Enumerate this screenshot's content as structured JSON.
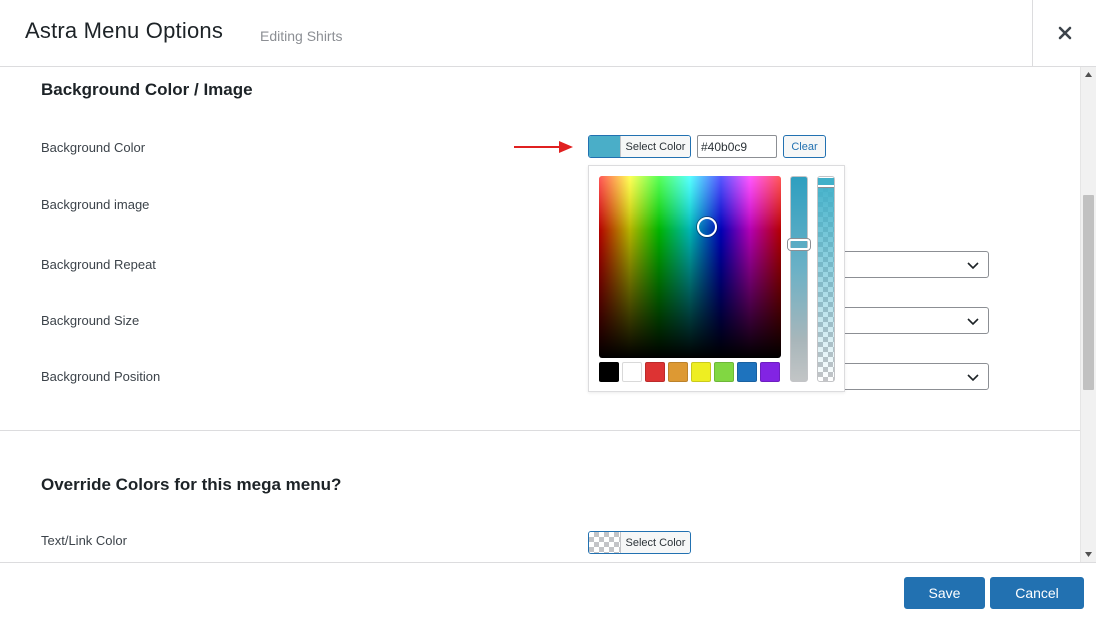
{
  "header": {
    "title": "Astra Menu Options",
    "subtitle": "Editing Shirts",
    "close_icon": "close-icon"
  },
  "sections": {
    "background": {
      "title": "Background Color / Image",
      "rows": {
        "color": "Background Color",
        "image": "Background image",
        "repeat": "Background Repeat",
        "size": "Background Size",
        "position": "Background Position"
      },
      "select_color_label": "Select Color",
      "hex_value": "#40b0c9",
      "clear_label": "Clear",
      "current_color": "#40b0c9"
    },
    "override": {
      "title": "Override Colors for this mega menu?",
      "rows": {
        "text_link": "Text/Link Color"
      },
      "select_color_label": "Select Color"
    }
  },
  "palette": [
    "#000000",
    "#ffffff",
    "#dd3333",
    "#dd9933",
    "#eeee22",
    "#81d742",
    "#1e73be",
    "#8224e3"
  ],
  "footer": {
    "save_label": "Save",
    "cancel_label": "Cancel"
  },
  "colors": {
    "accent": "#2271b1",
    "annotation_arrow": "#e02020"
  }
}
